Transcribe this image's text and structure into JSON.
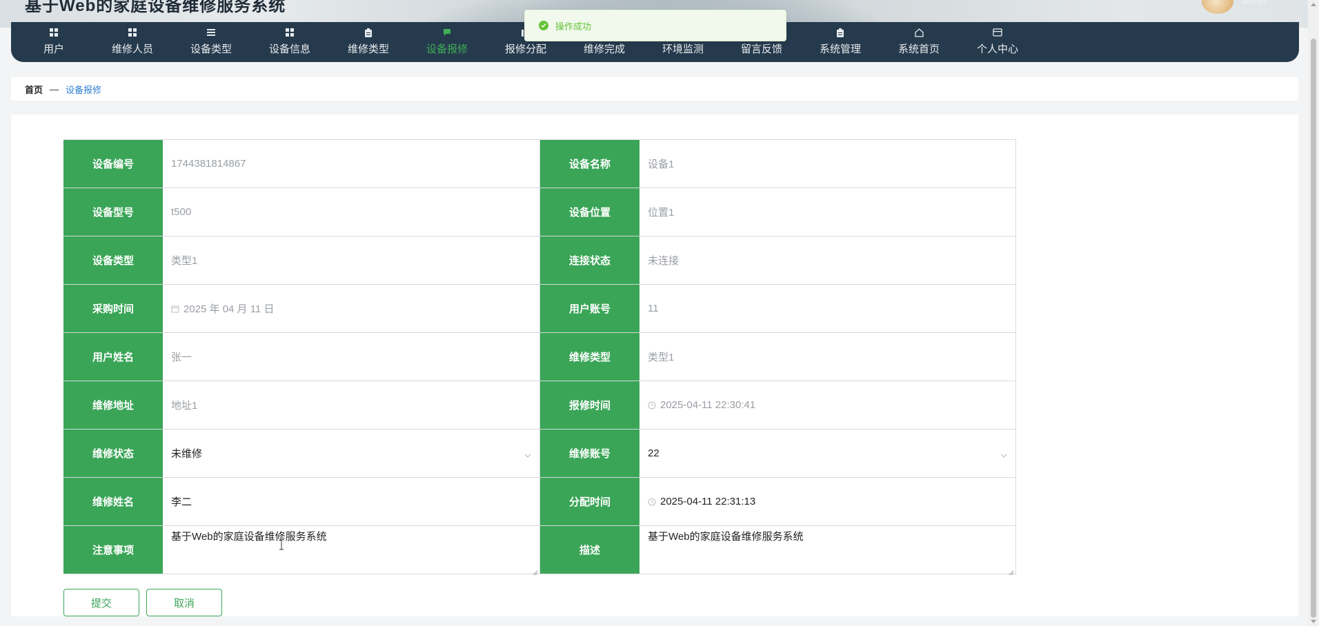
{
  "site": {
    "title": "基于Web的家庭设备维修服务系统",
    "user_name": "admin"
  },
  "nav": {
    "items": [
      {
        "label": "用户",
        "icon": "grid-icon"
      },
      {
        "label": "维修人员",
        "icon": "grid-icon"
      },
      {
        "label": "设备类型",
        "icon": "list-icon"
      },
      {
        "label": "设备信息",
        "icon": "grid-icon"
      },
      {
        "label": "维修类型",
        "icon": "clipboard-icon"
      },
      {
        "label": "设备报修",
        "icon": "chat-icon",
        "active": true
      },
      {
        "label": "报修分配",
        "icon": "chart-icon"
      },
      {
        "label": "维修完成",
        "icon": "grid-icon"
      },
      {
        "label": "环境监测",
        "icon": "grid-icon"
      },
      {
        "label": "留言反馈",
        "icon": "grid-icon"
      },
      {
        "label": "系统管理",
        "icon": "clipboard-icon"
      },
      {
        "label": "系统首页",
        "icon": "home-icon"
      },
      {
        "label": "个人中心",
        "icon": "card-icon"
      }
    ]
  },
  "toast": {
    "message": "操作成功"
  },
  "breadcrumb": {
    "home": "首页",
    "separator": "—",
    "current": "设备报修"
  },
  "form": {
    "rows": [
      [
        {
          "label": "设备编号",
          "value": "1744381814867"
        },
        {
          "label": "设备名称",
          "value": "设备1"
        }
      ],
      [
        {
          "label": "设备型号",
          "value": "t500"
        },
        {
          "label": "设备位置",
          "value": "位置1"
        }
      ],
      [
        {
          "label": "设备类型",
          "value": "类型1"
        },
        {
          "label": "连接状态",
          "value": "未连接"
        }
      ],
      [
        {
          "label": "采购时间",
          "value": "2025 年 04 月 11 日"
        },
        {
          "label": "用户账号",
          "value": "11"
        }
      ],
      [
        {
          "label": "用户姓名",
          "value": "张一"
        },
        {
          "label": "维修类型",
          "value": "类型1"
        }
      ],
      [
        {
          "label": "维修地址",
          "value": "地址1"
        },
        {
          "label": "报修时间",
          "value": "2025-04-11 22:30:41"
        }
      ],
      [
        {
          "label": "维修状态",
          "value": "未维修"
        },
        {
          "label": "维修账号",
          "value": "22"
        }
      ],
      [
        {
          "label": "维修姓名",
          "value": "李二"
        },
        {
          "label": "分配时间",
          "value": "2025-04-11 22:31:13"
        }
      ],
      [
        {
          "label": "注意事项",
          "value": "基于Web的家庭设备维修服务系统"
        },
        {
          "label": "描述",
          "value": "基于Web的家庭设备维修服务系统"
        }
      ]
    ]
  },
  "buttons": {
    "submit": "提交",
    "cancel": "取消"
  },
  "colors": {
    "primary_green": "#3aa557",
    "nav_bg": "#263a4d",
    "active_nav": "#3fae56",
    "breadcrumb_link": "#2f7fd1",
    "toast_text": "#67c23a"
  }
}
